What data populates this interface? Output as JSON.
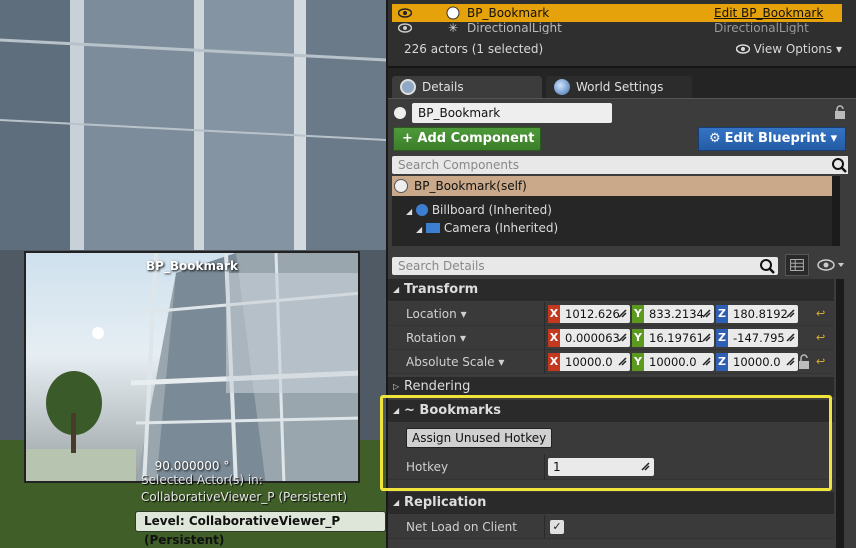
{
  "viewport": {
    "preview_title": "BP_Bookmark",
    "preview_fov": "90.000000 °",
    "selected_line1": "Selected Actor(s) in:",
    "selected_line2": "CollaborativeViewer_P (Persistent)",
    "level_badge": "Level:  CollaborativeViewer_P (Persistent)"
  },
  "outliner": {
    "rows": [
      {
        "name": "BP_Bookmark",
        "type": "Edit BP_Bookmark"
      },
      {
        "name": "DirectionalLight",
        "type": "DirectionalLight"
      }
    ],
    "actor_count": "226 actors (1 selected)",
    "view_options": "View Options ▾"
  },
  "tabs": {
    "details": "Details",
    "world_settings": "World Settings"
  },
  "details": {
    "actor_name": "BP_Bookmark",
    "add_component": "+ Add Component ▾",
    "edit_blueprint": "Edit Blueprint ▾",
    "search_components_placeholder": "Search Components",
    "search_details_placeholder": "Search Details",
    "components": {
      "self": "BP_Bookmark(self)",
      "billboard": "Billboard (Inherited)",
      "camera": "Camera (Inherited)",
      "cut": "..................."
    },
    "transform": {
      "header": "Transform",
      "location_label": "Location ▾",
      "rotation_label": "Rotation ▾",
      "scale_label": "Absolute Scale ▾",
      "location": [
        "1012.626",
        "833.2134",
        "180.8192"
      ],
      "rotation": [
        "0.000063",
        "16.19761",
        "-147.795"
      ],
      "scale": [
        "10000.0",
        "10000.0",
        "10000.0"
      ]
    },
    "rendering_header": "Rendering",
    "bookmarks": {
      "header": "~ Bookmarks",
      "assign_button": "Assign Unused Hotkey",
      "hotkey_label": "Hotkey",
      "hotkey_value": "1"
    },
    "replication": {
      "header": "Replication",
      "net_load_label": "Net Load on Client"
    }
  }
}
